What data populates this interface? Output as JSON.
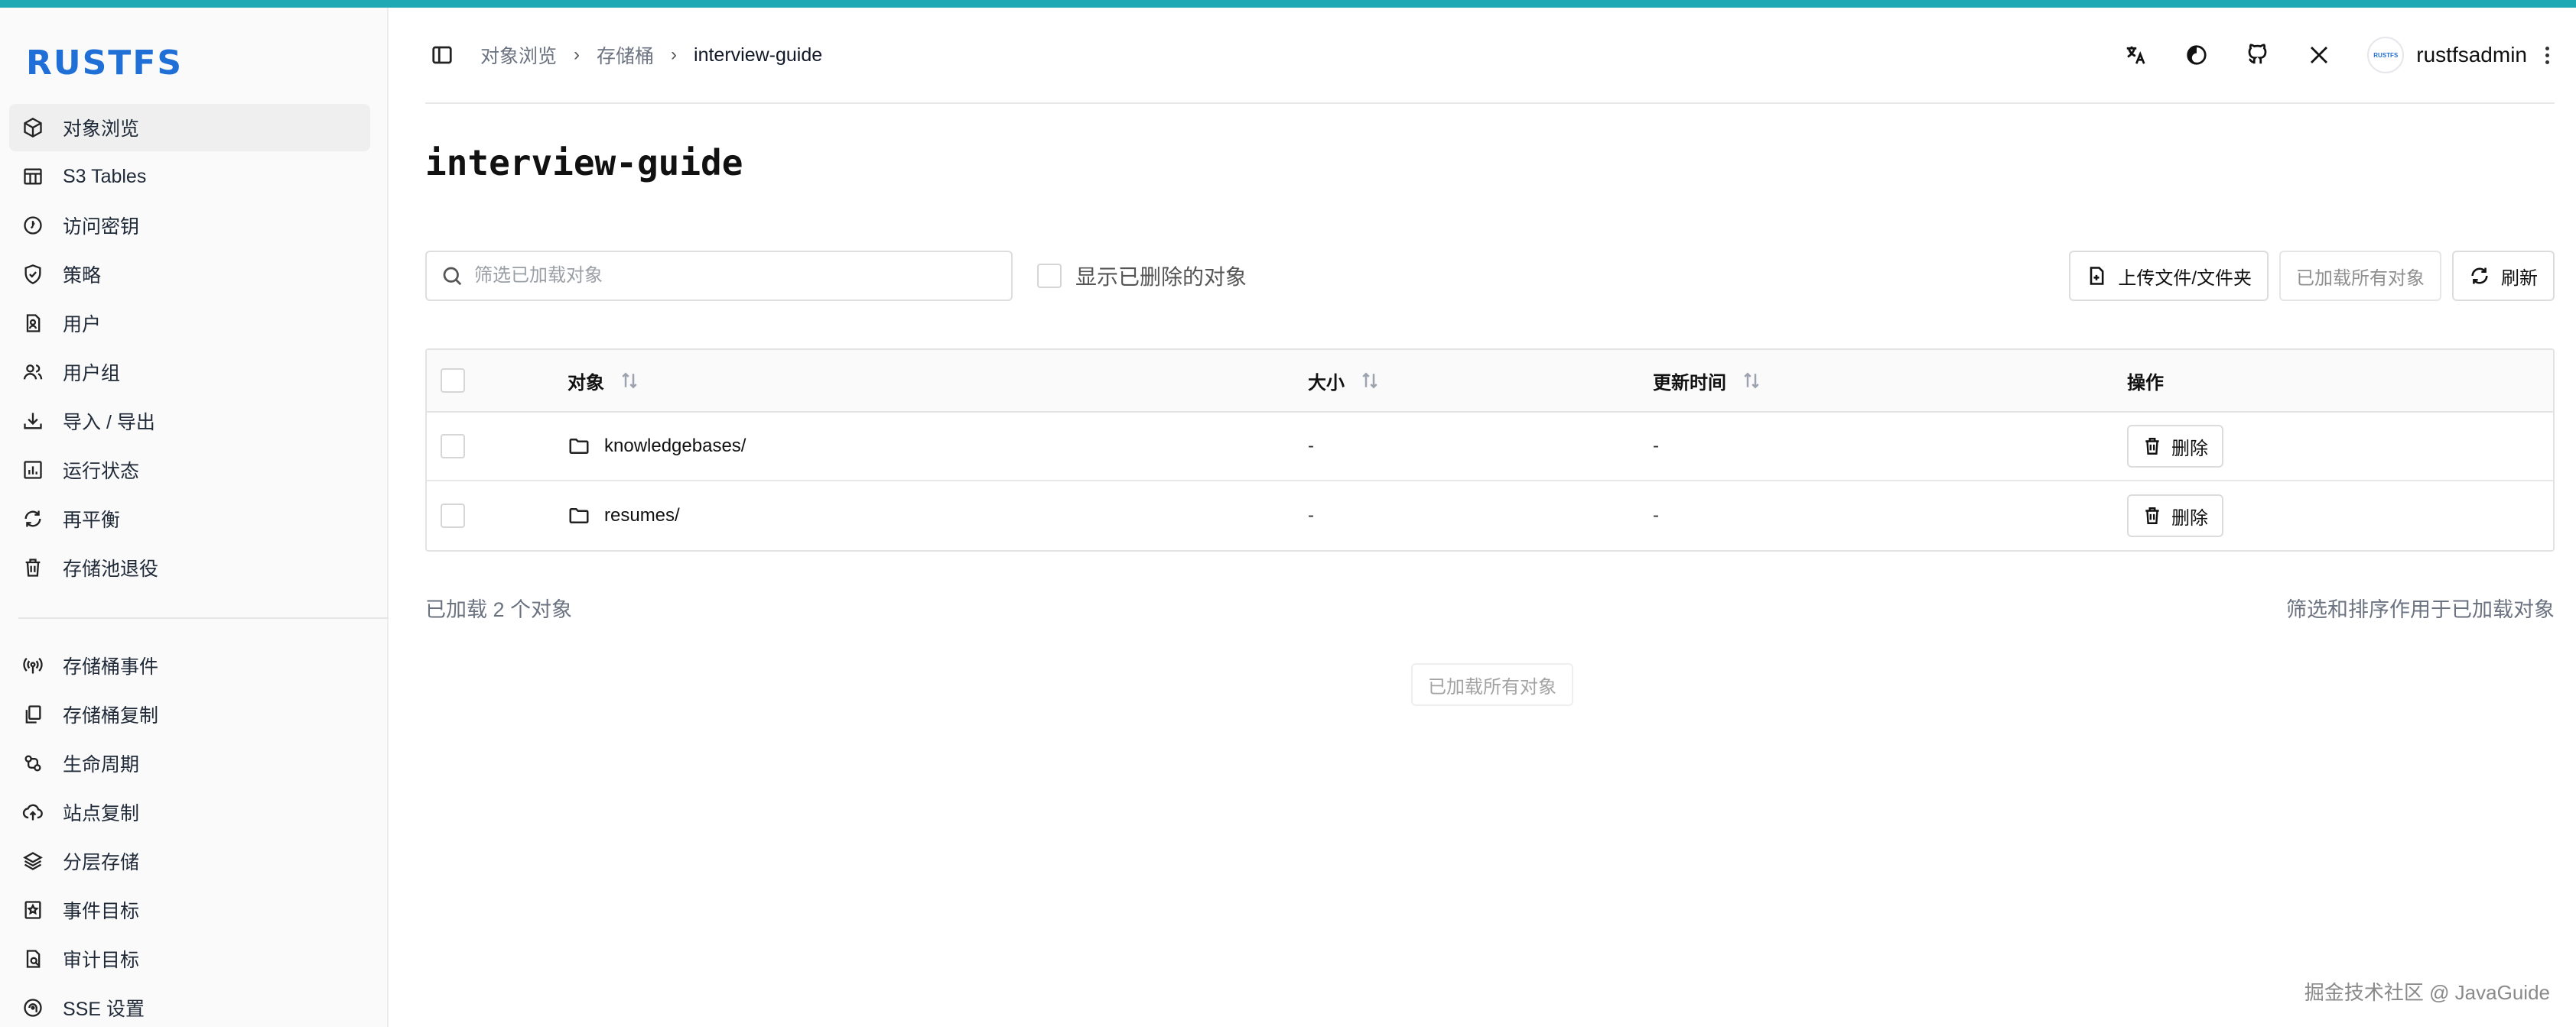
{
  "brand": {
    "logo_text": "RUSTFS",
    "accent": "#1fa9b5",
    "logo_color": "#1f6fd6"
  },
  "sidebar": {
    "items": [
      {
        "label": "对象浏览",
        "icon": "cube-icon",
        "active": true
      },
      {
        "label": "S3 Tables",
        "icon": "table-icon"
      },
      {
        "label": "访问密钥",
        "icon": "key-circle-icon"
      },
      {
        "label": "策略",
        "icon": "shield-check-icon"
      },
      {
        "label": "用户",
        "icon": "user-badge-icon"
      },
      {
        "label": "用户组",
        "icon": "users-icon"
      },
      {
        "label": "导入 / 导出",
        "icon": "download-icon"
      },
      {
        "label": "运行状态",
        "icon": "bar-chart-icon"
      },
      {
        "label": "再平衡",
        "icon": "refresh-icon"
      },
      {
        "label": "存储池退役",
        "icon": "trash-icon"
      }
    ],
    "items2": [
      {
        "label": "存储桶事件",
        "icon": "broadcast-icon"
      },
      {
        "label": "存储桶复制",
        "icon": "copy-icon"
      },
      {
        "label": "生命周期",
        "icon": "lifecycle-icon"
      },
      {
        "label": "站点复制",
        "icon": "cloud-upload-icon"
      },
      {
        "label": "分层存储",
        "icon": "layers-icon"
      },
      {
        "label": "事件目标",
        "icon": "star-bookmark-icon"
      },
      {
        "label": "审计目标",
        "icon": "audit-file-icon"
      },
      {
        "label": "SSE 设置",
        "icon": "sse-icon"
      }
    ]
  },
  "header": {
    "breadcrumb": [
      "对象浏览",
      "存储桶",
      "interview-guide"
    ],
    "username": "rustfsadmin",
    "avatar_text": "RUSTFS"
  },
  "page": {
    "title": "interview-guide"
  },
  "toolbar": {
    "search_placeholder": "筛选已加载对象",
    "show_deleted_label": "显示已删除的对象",
    "upload_label": "上传文件/文件夹",
    "loaded_all_label": "已加载所有对象",
    "refresh_label": "刷新"
  },
  "table": {
    "headers": {
      "object": "对象",
      "size": "大小",
      "updated": "更新时间",
      "actions": "操作"
    },
    "rows": [
      {
        "name": "knowledgebases/",
        "size": "-",
        "updated": "-",
        "action": "删除"
      },
      {
        "name": "resumes/",
        "size": "-",
        "updated": "-",
        "action": "删除"
      }
    ]
  },
  "footer": {
    "count_text": "已加载 2 个对象",
    "note_text": "筛选和排序作用于已加载对象",
    "loaded_all_button": "已加载所有对象"
  },
  "watermark": "掘金技术社区 @ JavaGuide"
}
